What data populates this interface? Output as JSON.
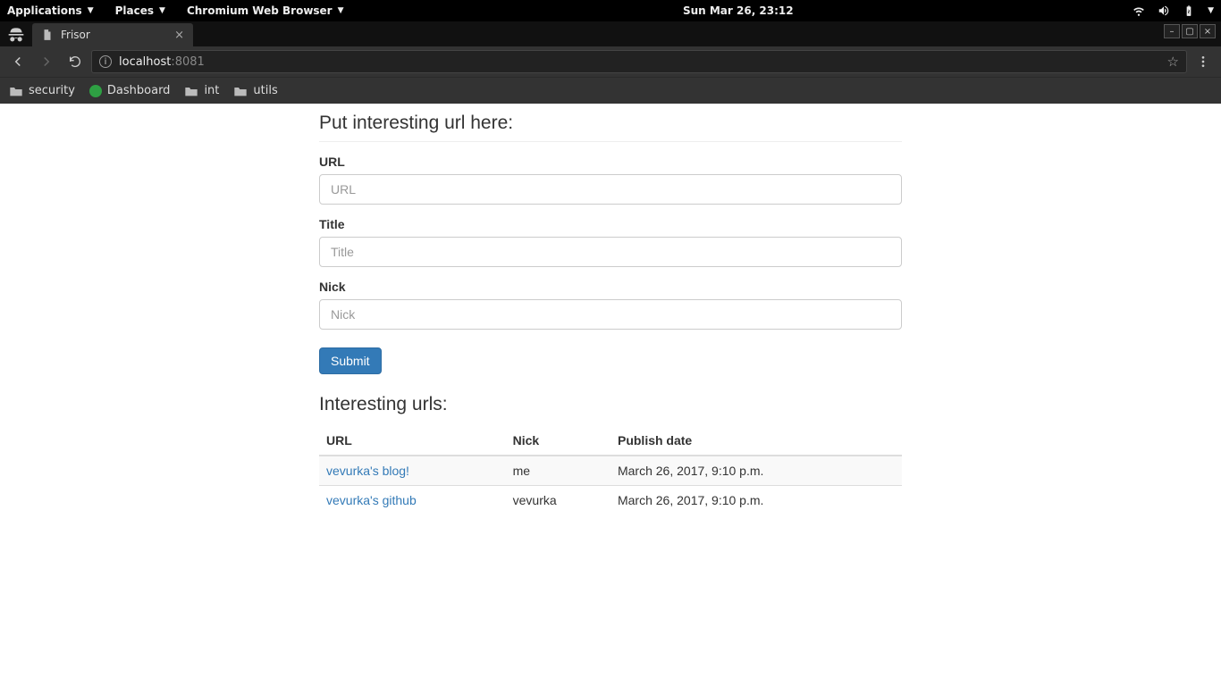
{
  "gnome": {
    "applications": "Applications",
    "places": "Places",
    "browser": "Chromium Web Browser",
    "clock": "Sun Mar 26, 23:12"
  },
  "tab": {
    "title": "Frisor"
  },
  "url": {
    "host": "localhost",
    "port": ":8081"
  },
  "bookmarks": {
    "security": "security",
    "dashboard": "Dashboard",
    "int": "int",
    "utils": "utils"
  },
  "page": {
    "form_heading": "Put interesting url here:",
    "url_label": "URL",
    "url_placeholder": "URL",
    "title_label": "Title",
    "title_placeholder": "Title",
    "nick_label": "Nick",
    "nick_placeholder": "Nick",
    "submit": "Submit",
    "list_heading": "Interesting urls:",
    "columns": {
      "url": "URL",
      "nick": "Nick",
      "date": "Publish date"
    },
    "rows": [
      {
        "title": "vevurka's blog!",
        "nick": "me",
        "date": "March 26, 2017, 9:10 p.m."
      },
      {
        "title": "vevurka's github",
        "nick": "vevurka",
        "date": "March 26, 2017, 9:10 p.m."
      }
    ]
  }
}
